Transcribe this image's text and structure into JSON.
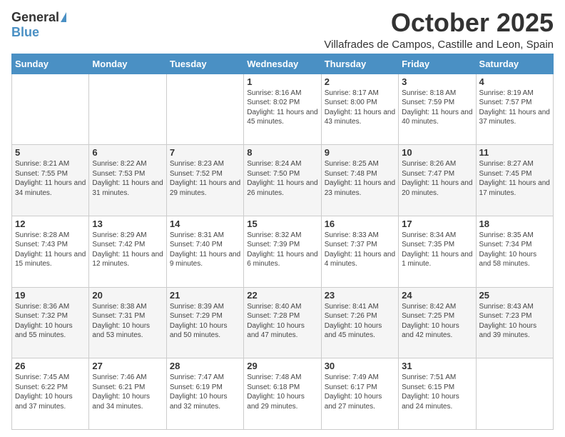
{
  "header": {
    "logo_general": "General",
    "logo_blue": "Blue",
    "month_title": "October 2025",
    "location": "Villafrades de Campos, Castille and Leon, Spain"
  },
  "days_of_week": [
    "Sunday",
    "Monday",
    "Tuesday",
    "Wednesday",
    "Thursday",
    "Friday",
    "Saturday"
  ],
  "weeks": [
    [
      {
        "day": "",
        "info": ""
      },
      {
        "day": "",
        "info": ""
      },
      {
        "day": "",
        "info": ""
      },
      {
        "day": "1",
        "info": "Sunrise: 8:16 AM\nSunset: 8:02 PM\nDaylight: 11 hours and 45 minutes."
      },
      {
        "day": "2",
        "info": "Sunrise: 8:17 AM\nSunset: 8:00 PM\nDaylight: 11 hours and 43 minutes."
      },
      {
        "day": "3",
        "info": "Sunrise: 8:18 AM\nSunset: 7:59 PM\nDaylight: 11 hours and 40 minutes."
      },
      {
        "day": "4",
        "info": "Sunrise: 8:19 AM\nSunset: 7:57 PM\nDaylight: 11 hours and 37 minutes."
      }
    ],
    [
      {
        "day": "5",
        "info": "Sunrise: 8:21 AM\nSunset: 7:55 PM\nDaylight: 11 hours and 34 minutes."
      },
      {
        "day": "6",
        "info": "Sunrise: 8:22 AM\nSunset: 7:53 PM\nDaylight: 11 hours and 31 minutes."
      },
      {
        "day": "7",
        "info": "Sunrise: 8:23 AM\nSunset: 7:52 PM\nDaylight: 11 hours and 29 minutes."
      },
      {
        "day": "8",
        "info": "Sunrise: 8:24 AM\nSunset: 7:50 PM\nDaylight: 11 hours and 26 minutes."
      },
      {
        "day": "9",
        "info": "Sunrise: 8:25 AM\nSunset: 7:48 PM\nDaylight: 11 hours and 23 minutes."
      },
      {
        "day": "10",
        "info": "Sunrise: 8:26 AM\nSunset: 7:47 PM\nDaylight: 11 hours and 20 minutes."
      },
      {
        "day": "11",
        "info": "Sunrise: 8:27 AM\nSunset: 7:45 PM\nDaylight: 11 hours and 17 minutes."
      }
    ],
    [
      {
        "day": "12",
        "info": "Sunrise: 8:28 AM\nSunset: 7:43 PM\nDaylight: 11 hours and 15 minutes."
      },
      {
        "day": "13",
        "info": "Sunrise: 8:29 AM\nSunset: 7:42 PM\nDaylight: 11 hours and 12 minutes."
      },
      {
        "day": "14",
        "info": "Sunrise: 8:31 AM\nSunset: 7:40 PM\nDaylight: 11 hours and 9 minutes."
      },
      {
        "day": "15",
        "info": "Sunrise: 8:32 AM\nSunset: 7:39 PM\nDaylight: 11 hours and 6 minutes."
      },
      {
        "day": "16",
        "info": "Sunrise: 8:33 AM\nSunset: 7:37 PM\nDaylight: 11 hours and 4 minutes."
      },
      {
        "day": "17",
        "info": "Sunrise: 8:34 AM\nSunset: 7:35 PM\nDaylight: 11 hours and 1 minute."
      },
      {
        "day": "18",
        "info": "Sunrise: 8:35 AM\nSunset: 7:34 PM\nDaylight: 10 hours and 58 minutes."
      }
    ],
    [
      {
        "day": "19",
        "info": "Sunrise: 8:36 AM\nSunset: 7:32 PM\nDaylight: 10 hours and 55 minutes."
      },
      {
        "day": "20",
        "info": "Sunrise: 8:38 AM\nSunset: 7:31 PM\nDaylight: 10 hours and 53 minutes."
      },
      {
        "day": "21",
        "info": "Sunrise: 8:39 AM\nSunset: 7:29 PM\nDaylight: 10 hours and 50 minutes."
      },
      {
        "day": "22",
        "info": "Sunrise: 8:40 AM\nSunset: 7:28 PM\nDaylight: 10 hours and 47 minutes."
      },
      {
        "day": "23",
        "info": "Sunrise: 8:41 AM\nSunset: 7:26 PM\nDaylight: 10 hours and 45 minutes."
      },
      {
        "day": "24",
        "info": "Sunrise: 8:42 AM\nSunset: 7:25 PM\nDaylight: 10 hours and 42 minutes."
      },
      {
        "day": "25",
        "info": "Sunrise: 8:43 AM\nSunset: 7:23 PM\nDaylight: 10 hours and 39 minutes."
      }
    ],
    [
      {
        "day": "26",
        "info": "Sunrise: 7:45 AM\nSunset: 6:22 PM\nDaylight: 10 hours and 37 minutes."
      },
      {
        "day": "27",
        "info": "Sunrise: 7:46 AM\nSunset: 6:21 PM\nDaylight: 10 hours and 34 minutes."
      },
      {
        "day": "28",
        "info": "Sunrise: 7:47 AM\nSunset: 6:19 PM\nDaylight: 10 hours and 32 minutes."
      },
      {
        "day": "29",
        "info": "Sunrise: 7:48 AM\nSunset: 6:18 PM\nDaylight: 10 hours and 29 minutes."
      },
      {
        "day": "30",
        "info": "Sunrise: 7:49 AM\nSunset: 6:17 PM\nDaylight: 10 hours and 27 minutes."
      },
      {
        "day": "31",
        "info": "Sunrise: 7:51 AM\nSunset: 6:15 PM\nDaylight: 10 hours and 24 minutes."
      },
      {
        "day": "",
        "info": ""
      }
    ]
  ]
}
